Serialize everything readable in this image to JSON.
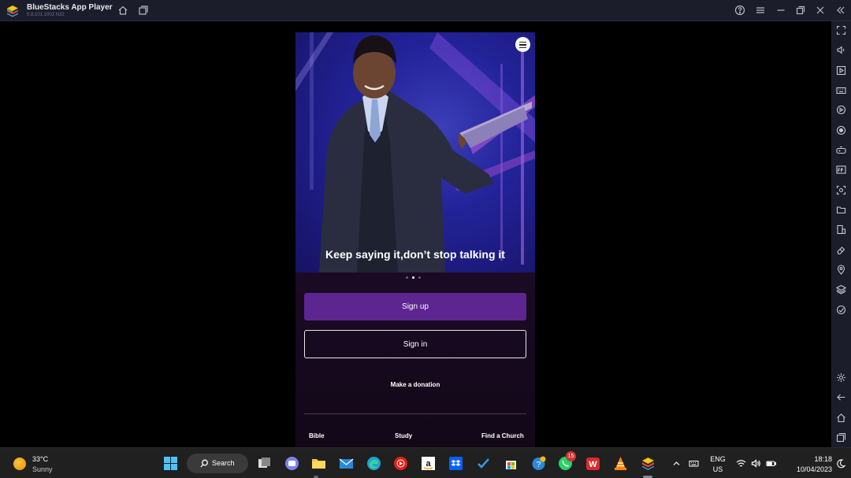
{
  "window": {
    "title": "BlueStacks App Player",
    "version": "5.8.101.1002 N32"
  },
  "app": {
    "hero_caption": "Keep saying it,don’t stop talking it",
    "carousel": {
      "count": 3,
      "active_index": 1
    },
    "signup_label": "Sign up",
    "signin_label": "Sign in",
    "donation_label": "Make a donation",
    "bottom_nav": [
      "Bible",
      "Study",
      "Find a Church"
    ],
    "colors": {
      "primary": "#5c2590",
      "background": "#1b0b26"
    }
  },
  "sidebar_icons": [
    "fullscreen-icon",
    "volume-icon",
    "media-icon",
    "keyboard-icon",
    "macro-icon",
    "record-icon",
    "gamepad-icon",
    "fps-icon",
    "screenshot-icon",
    "folder-icon",
    "multi-instance-icon",
    "eraser-icon",
    "location-icon",
    "layers-icon",
    "sync-icon",
    "settings-icon",
    "back-icon",
    "home-icon",
    "recents-icon"
  ],
  "taskbar": {
    "weather_temp": "33°C",
    "weather_desc": "Sunny",
    "search_label": "Search",
    "mail_badge": "15",
    "lang_line1": "ENG",
    "lang_line2": "US",
    "time": "18:18",
    "date": "10/04/2023"
  }
}
